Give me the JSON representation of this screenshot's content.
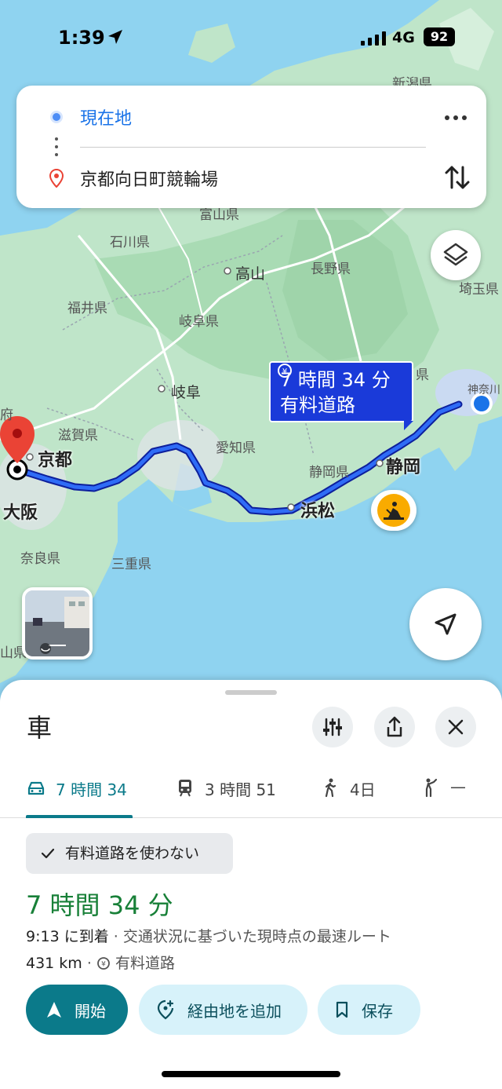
{
  "status_bar": {
    "time": "1:39",
    "network": "4G",
    "battery": "92"
  },
  "route_inputs": {
    "origin": "現在地",
    "destination": "京都向日町競輪場"
  },
  "map": {
    "labels": {
      "niigata": "新潟県",
      "toyama": "富山県",
      "ishikawa": "石川県",
      "takayama": "高山",
      "nagano": "長野県",
      "saitama": "埼玉県",
      "fukui": "福井県",
      "gifu_pref": "岐阜県",
      "gifu": "岐阜",
      "shiga": "滋賀県",
      "aichi": "愛知県",
      "shizuoka_pref": "静岡県",
      "mie": "三重県",
      "nara": "奈良県",
      "kanagawa": "神奈川",
      "fu": "府",
      "ken": "県",
      "yama": "山県"
    },
    "cities": {
      "kyoto": "京都",
      "osaka": "大阪",
      "hamamatsu": "浜松",
      "shizuoka": "静岡"
    },
    "callout": {
      "time": "7 時間 34 分",
      "toll": "有料道路"
    }
  },
  "sheet": {
    "title": "車",
    "tabs": [
      {
        "label": "7 時間 34",
        "icon": "car-icon"
      },
      {
        "label": "3 時間 51",
        "icon": "train-icon"
      },
      {
        "label": "4日",
        "icon": "walk-icon"
      },
      {
        "label": "—",
        "icon": "ride-icon"
      }
    ],
    "chip": "有料道路を使わない",
    "duration": "7 時間 34 分",
    "arrival_time": "9:13 に到着",
    "arrival_note": " · 交通状況に基づいた現時点の最速ルート",
    "distance": "431 km",
    "toll_note": "有料道路",
    "buttons": {
      "start": "開始",
      "add_stop": "経由地を追加",
      "save": "保存"
    }
  },
  "colors": {
    "accent": "#0b7a8a",
    "route": "#1a3ad9",
    "duration": "#188038",
    "link": "#1a73e8"
  }
}
